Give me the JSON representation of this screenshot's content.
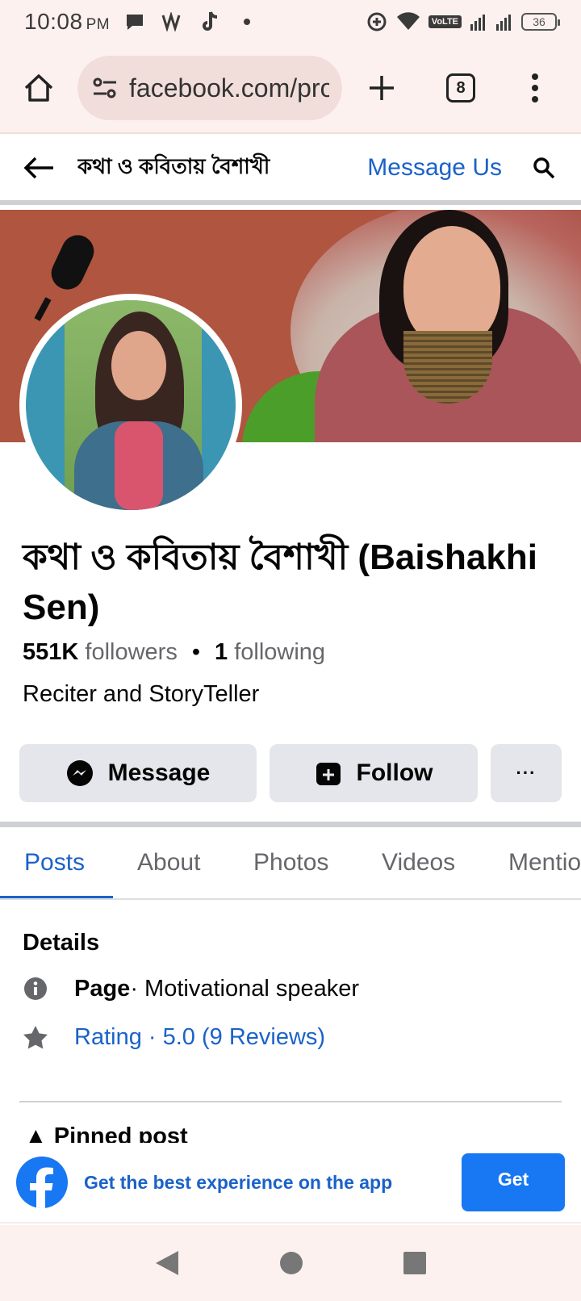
{
  "status_bar": {
    "time": "10:08",
    "ampm": "PM",
    "network": "VoLTE",
    "battery": "36"
  },
  "browser": {
    "url": "facebook.com/pro",
    "tab_count": "8"
  },
  "header": {
    "title": "কথা ও কবিতায় বৈশাখী",
    "message_us": "Message Us"
  },
  "profile": {
    "name": "কথা ও কবিতায় বৈশাখী (Baishakhi Sen)",
    "followers_count": "551K",
    "followers_label": "followers",
    "following_count": "1",
    "following_label": "following",
    "bio": "Reciter and StoryTeller"
  },
  "actions": {
    "message": "Message",
    "follow": "Follow",
    "more": "···"
  },
  "tabs": [
    "Posts",
    "About",
    "Photos",
    "Videos",
    "Mentions"
  ],
  "details": {
    "title": "Details",
    "page_label": "Page",
    "page_category": " · Motivational speaker",
    "rating": "Rating · 5.0 (9 Reviews)"
  },
  "pinned_label": "Pinned post",
  "app_banner": {
    "text": "Get the best experience on the app",
    "button": "Get"
  },
  "colors": {
    "accent": "#1b62c9",
    "facebook_blue": "#1877f2",
    "button_gray": "#e4e6eb"
  }
}
